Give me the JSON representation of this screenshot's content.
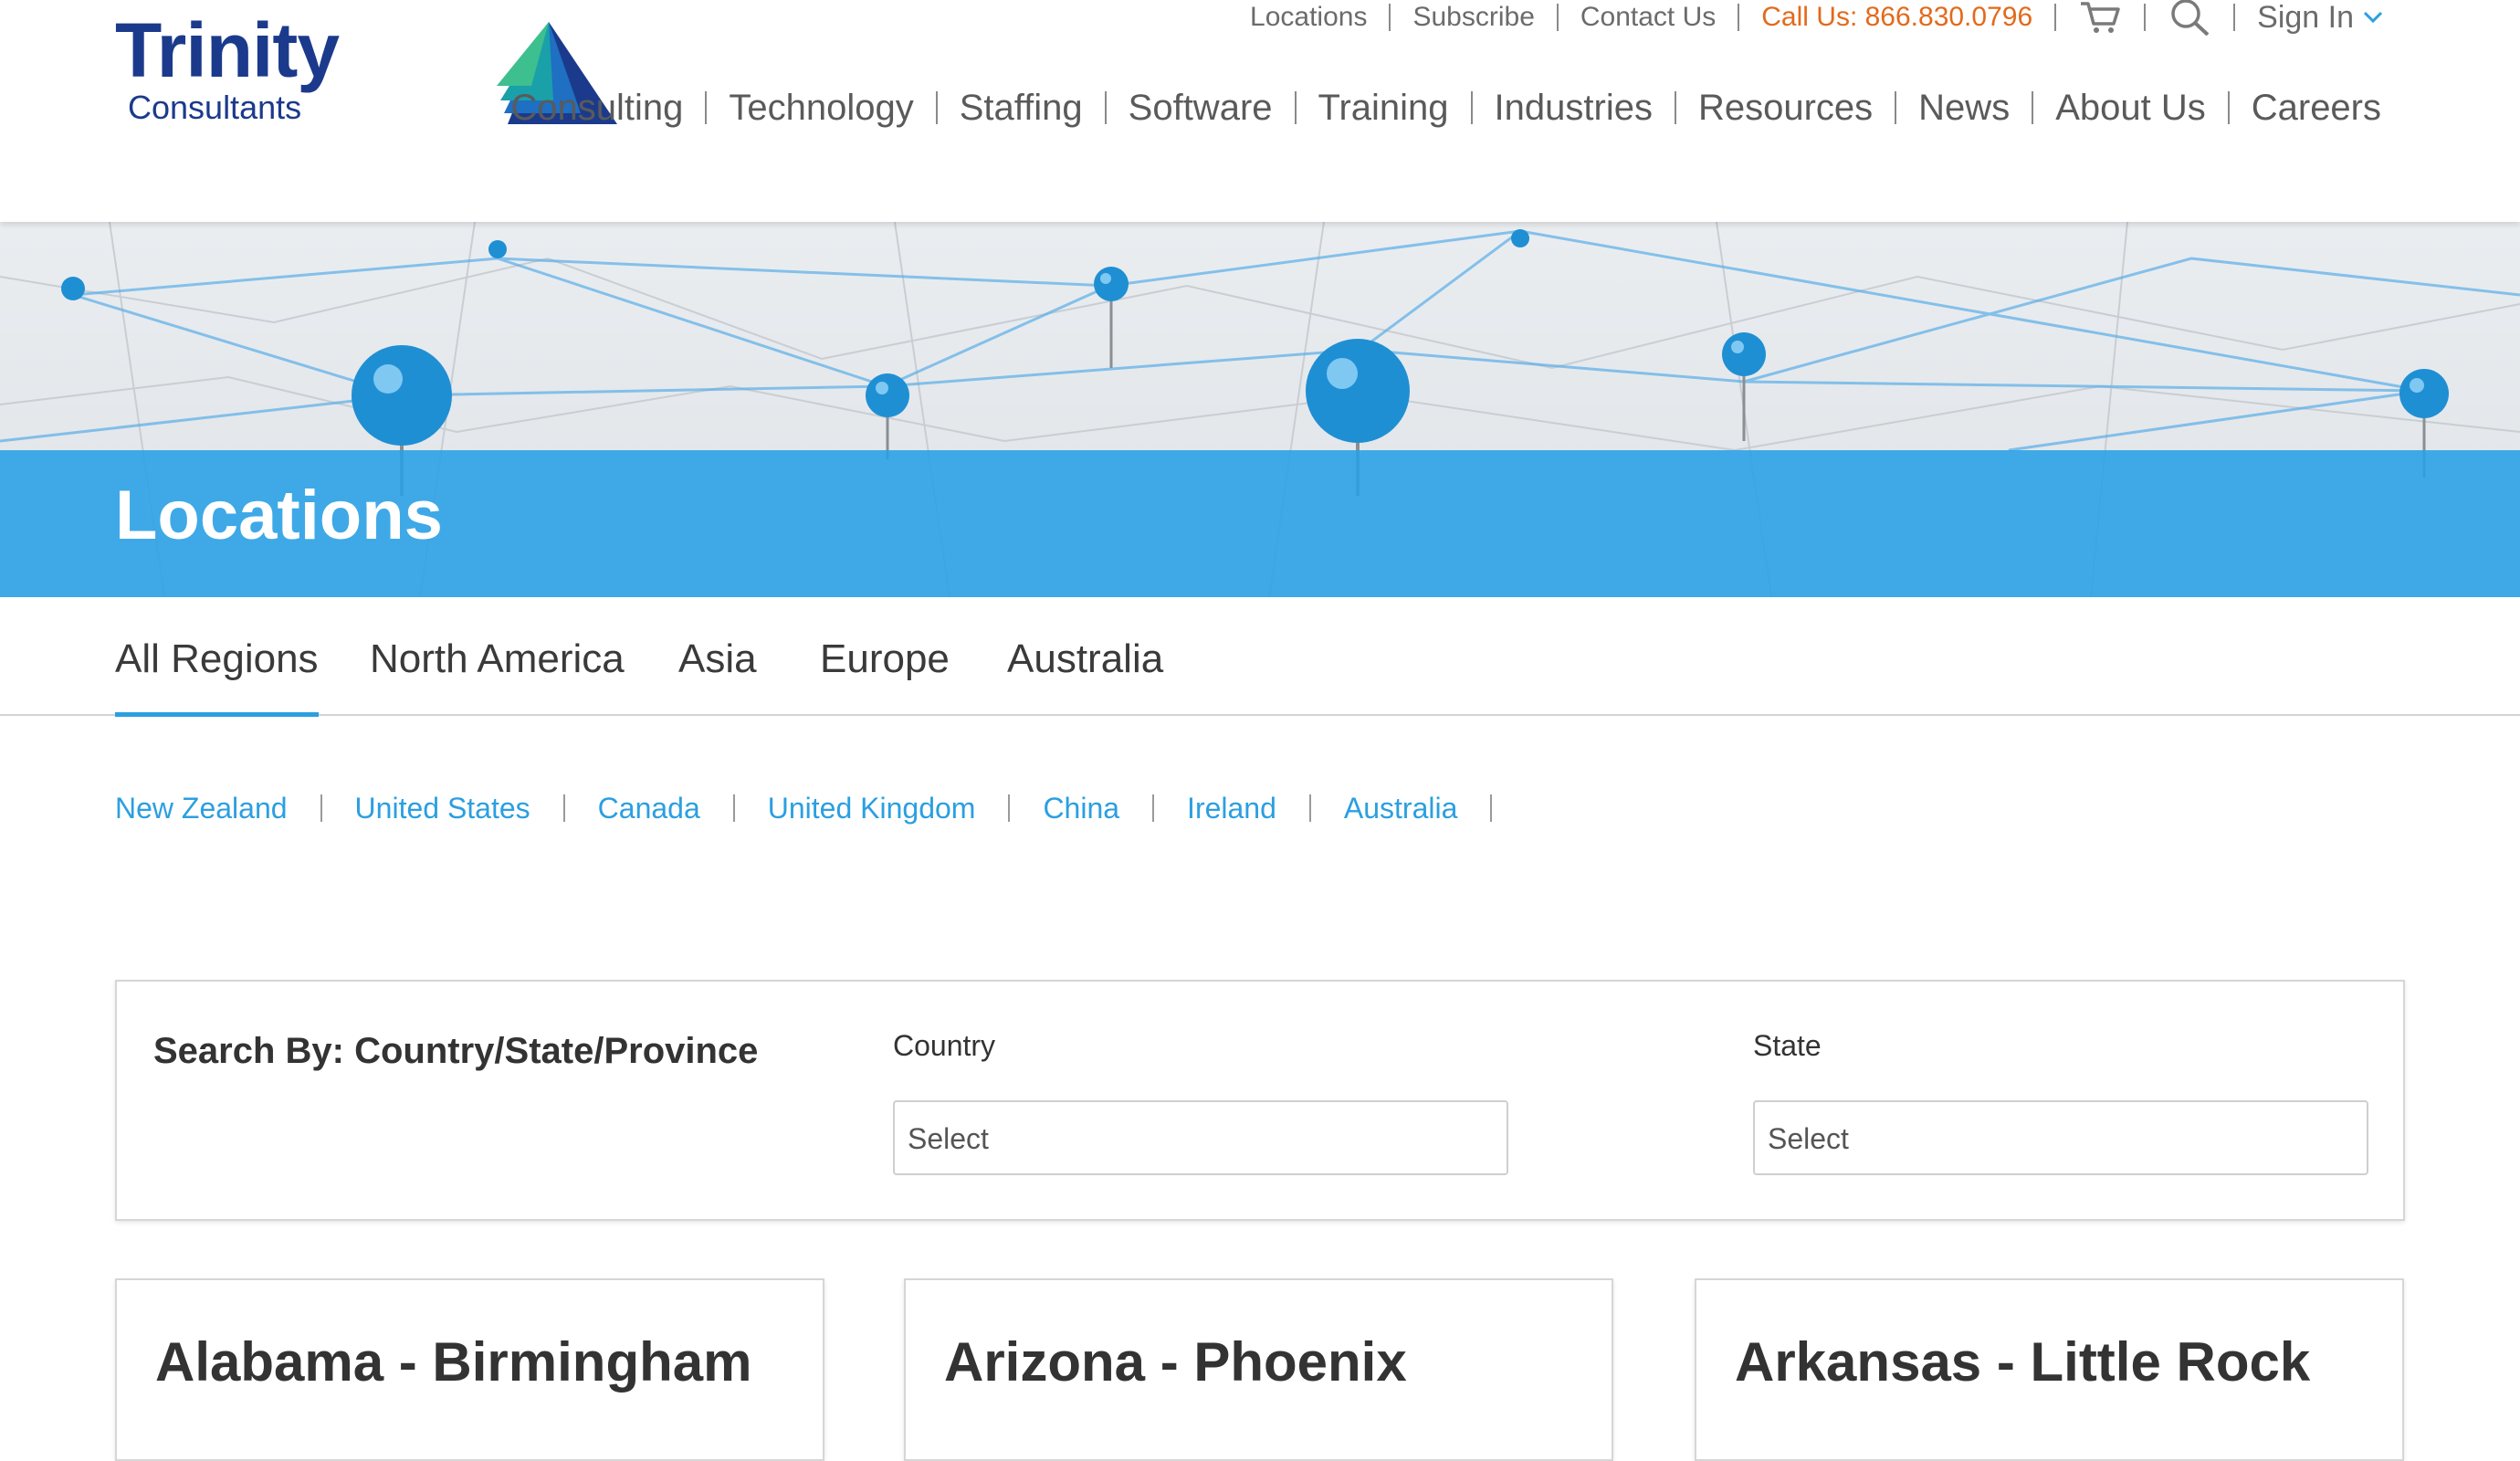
{
  "brand": {
    "logo_word": "Trinity",
    "logo_sub": "Consultants",
    "colors": {
      "navy": "#1b3a8c",
      "accent_blue": "#2b9fe0",
      "phone_orange": "#e26a1b",
      "hero_band": "#28a0e6"
    }
  },
  "utility_nav": {
    "locations": "Locations",
    "subscribe": "Subscribe",
    "contact": "Contact Us",
    "phone": "Call Us: 866.830.0796",
    "cart_icon": "cart-icon",
    "search_icon": "search-icon",
    "signin": "Sign In"
  },
  "main_nav": {
    "items": [
      "Consulting",
      "Technology",
      "Staffing",
      "Software",
      "Training",
      "Industries",
      "Resources",
      "News",
      "About Us",
      "Careers"
    ]
  },
  "hero": {
    "title": "Locations"
  },
  "region_tabs": {
    "active": "All Regions",
    "items": [
      "All Regions",
      "North America",
      "Asia",
      "Europe",
      "Australia"
    ]
  },
  "country_links": [
    "New Zealand",
    "United States",
    "Canada",
    "United Kingdom",
    "China",
    "Ireland",
    "Australia"
  ],
  "search": {
    "title": "Search By: Country/State/Province",
    "country_label": "Country",
    "country_value": "Select",
    "state_label": "State",
    "state_value": "Select"
  },
  "location_cards": [
    "Alabama - Birmingham",
    "Arizona - Phoenix",
    "Arkansas - Little Rock"
  ]
}
